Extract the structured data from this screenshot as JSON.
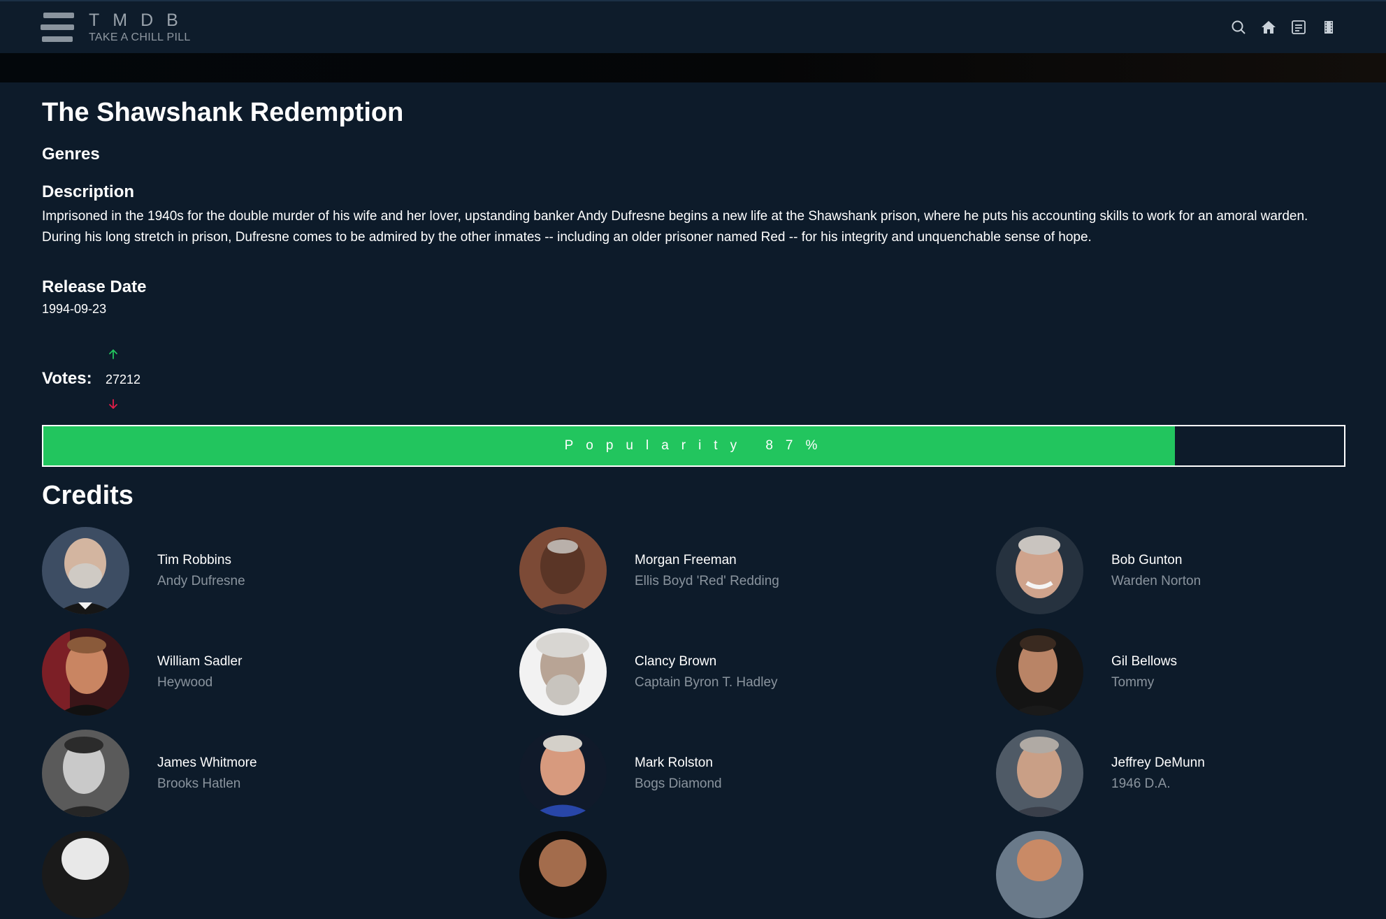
{
  "header": {
    "brand_title": "TMDB",
    "brand_tagline": "TAKE A CHILL PILL",
    "icons": [
      "search-icon",
      "home-icon",
      "list-icon",
      "film-icon"
    ]
  },
  "movie": {
    "title": "The Shawshank Redemption",
    "genres_heading": "Genres",
    "description_heading": "Description",
    "description": "Imprisoned in the 1940s for the double murder of his wife and her lover, upstanding banker Andy Dufresne begins a new life at the Shawshank prison, where he puts his accounting skills to work for an amoral warden. During his long stretch in prison, Dufresne comes to be admired by the other inmates -- including an older prisoner named Red -- for his integrity and unquenchable sense of hope.",
    "release_heading": "Release Date",
    "release_date": "1994-09-23",
    "votes_label": "Votes:",
    "votes_count": "27212",
    "popularity_label": "Popularity 87%",
    "popularity_fraction": 0.87
  },
  "credits": {
    "heading": "Credits",
    "people": [
      {
        "name": "Tim Robbins",
        "role": "Andy Dufresne"
      },
      {
        "name": "Morgan Freeman",
        "role": "Ellis Boyd 'Red' Redding"
      },
      {
        "name": "Bob Gunton",
        "role": "Warden Norton"
      },
      {
        "name": "William Sadler",
        "role": "Heywood"
      },
      {
        "name": "Clancy Brown",
        "role": "Captain Byron T. Hadley"
      },
      {
        "name": "Gil Bellows",
        "role": "Tommy"
      },
      {
        "name": "James Whitmore",
        "role": "Brooks Hatlen"
      },
      {
        "name": "Mark Rolston",
        "role": "Bogs Diamond"
      },
      {
        "name": "Jeffrey DeMunn",
        "role": "1946 D.A."
      }
    ]
  },
  "colors": {
    "background": "#0d1b2a",
    "accent_green": "#22c55e",
    "vote_up": "#22c55e",
    "vote_down": "#e11d48",
    "muted_text": "#8a949e"
  }
}
